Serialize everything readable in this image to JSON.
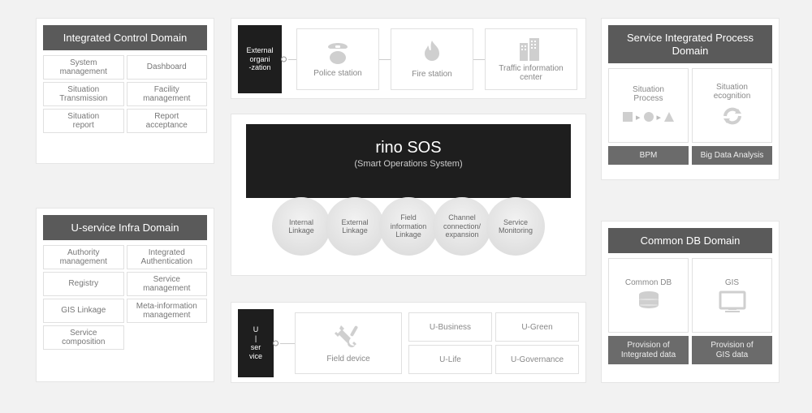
{
  "integrated_control": {
    "title": "Integrated Control Domain",
    "cells": [
      "System\nmanagement",
      "Dashboard",
      "Situation\nTransmission",
      "Facility\nmanagement",
      "Situation\nreport",
      "Report\nacceptance"
    ]
  },
  "uservice_infra": {
    "title": "U-service Infra Domain",
    "cells": [
      "Authority\nmanagement",
      "Integrated\nAuthentication",
      "Registry",
      "Service\nmanagement",
      "GIS Linkage",
      "Meta-information\nmanagement",
      "Service\ncomposition"
    ]
  },
  "external_orgs": {
    "tab": "External\norgani\n-zation",
    "items": [
      "Police station",
      "Fire station",
      "Traffic information\ncenter"
    ]
  },
  "rino": {
    "title": "rino SOS",
    "subtitle": "(Smart Operations System)",
    "circles": [
      "Internal\nLinkage",
      "External\nLinkage",
      "Field\ninformation\nLinkage",
      "Channel\nconnection/\nexpansion",
      "Service\nMonitoring"
    ]
  },
  "userv_row": {
    "tab": "U\n|\nser\nvice",
    "field": "Field device",
    "grid": [
      "U-Business",
      "U-Green",
      "U-Life",
      "U-Governance"
    ]
  },
  "service_proc": {
    "title": "Service Integrated Process\nDomain",
    "left_label": "Situation\nProcess",
    "right_label": "Situation\necognition",
    "left_badge": "BPM",
    "right_badge": "Big Data Analysis"
  },
  "common_db": {
    "title": "Common DB Domain",
    "left_label": "Common DB",
    "right_label": "GIS",
    "left_badge": "Provision of\nIntegrated data",
    "right_badge": "Provision of\nGIS data"
  }
}
